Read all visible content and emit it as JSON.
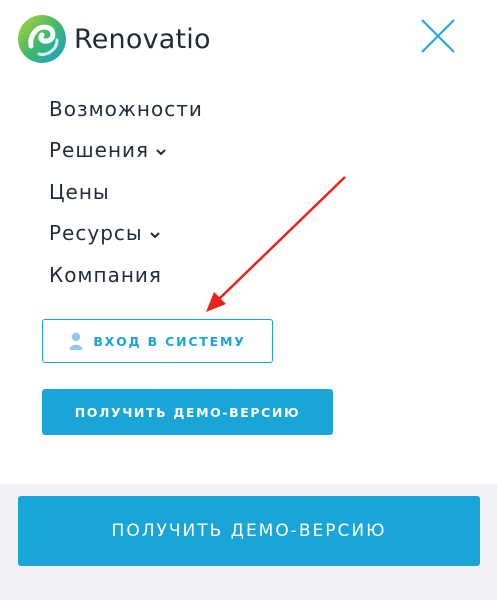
{
  "logo": {
    "text": "Renovatio",
    "icon": "renovatio-swirl-logo"
  },
  "header": {
    "close_icon": "close-x-icon",
    "close_color": "#2aa9d6"
  },
  "nav": {
    "items": [
      {
        "label": "Возможности",
        "has_dropdown": false
      },
      {
        "label": "Решения",
        "has_dropdown": true
      },
      {
        "label": "Цены",
        "has_dropdown": false
      },
      {
        "label": "Ресурсы",
        "has_dropdown": true
      },
      {
        "label": "Компания",
        "has_dropdown": false
      }
    ]
  },
  "buttons": {
    "login": {
      "label": "ВХОД В СИСТЕМУ",
      "icon": "user-icon"
    },
    "demo_small": {
      "label": "ПОЛУЧИТЬ ДЕМО-ВЕРСИЮ"
    },
    "demo_big": {
      "label": "ПОЛУЧИТЬ ДЕМО-ВЕРСИЮ"
    }
  },
  "annotation": {
    "type": "red-arrow",
    "color": "#e8231b"
  },
  "colors": {
    "accent": "#1aa5d8",
    "text": "#1f2d3d",
    "background": "#f0f2f6"
  }
}
